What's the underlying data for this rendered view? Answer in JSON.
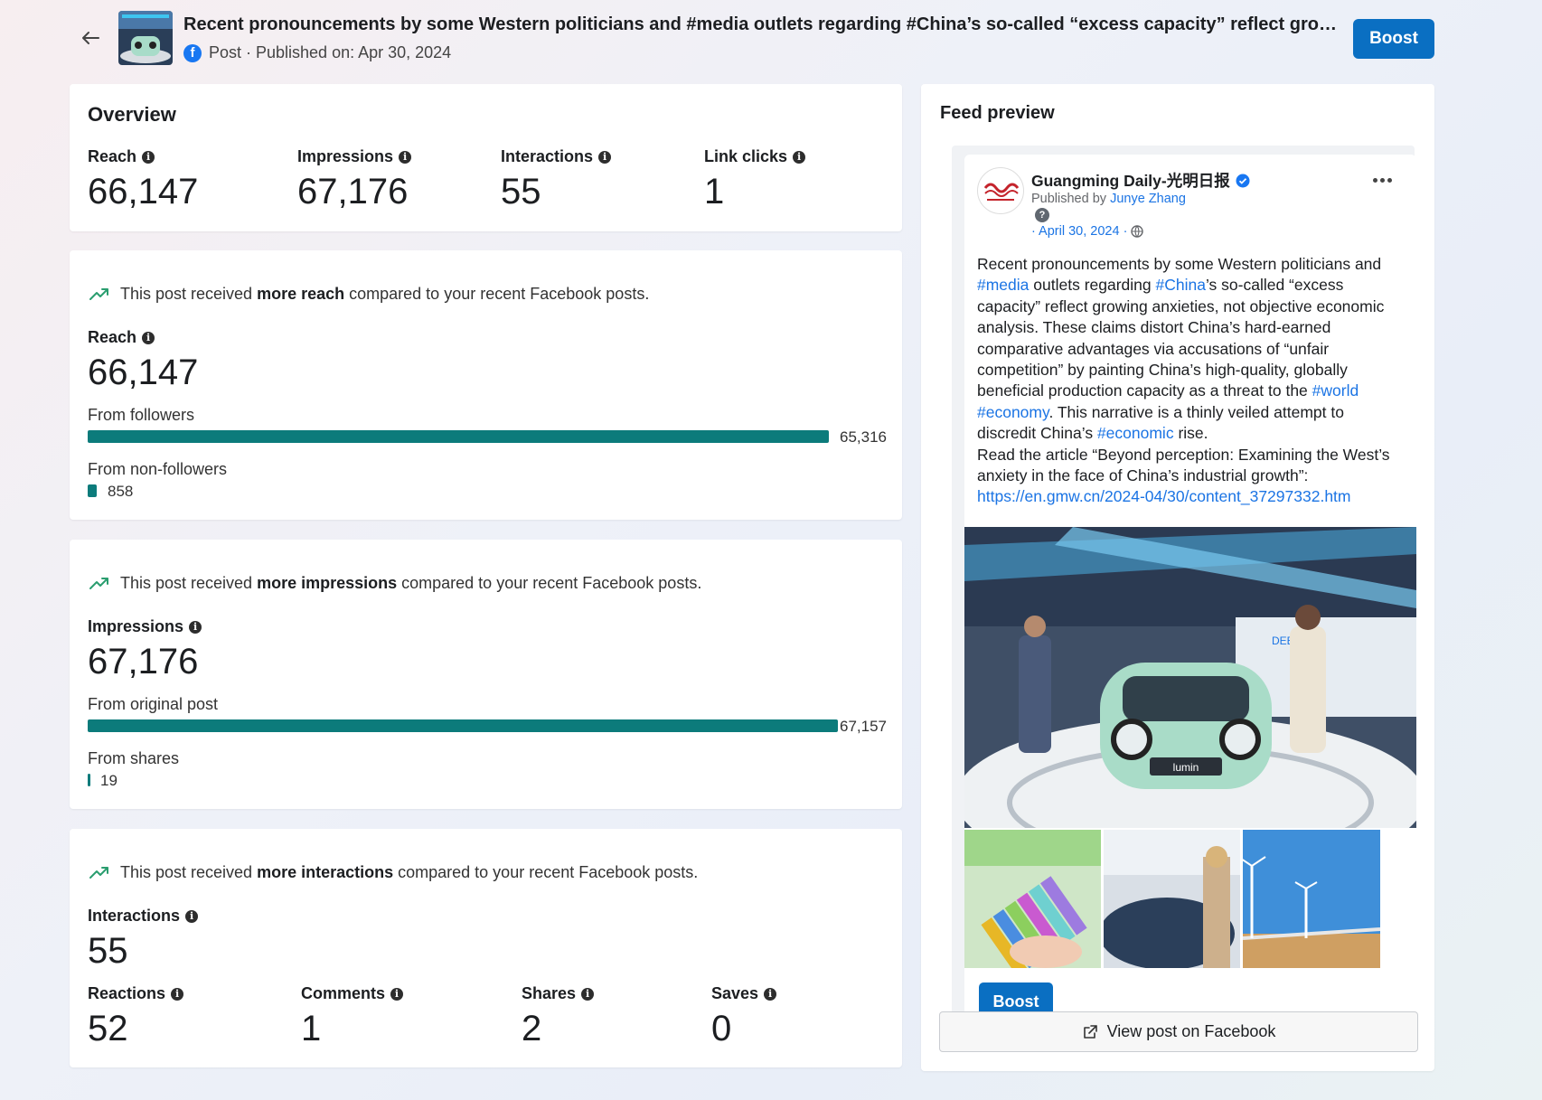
{
  "header": {
    "title": "Recent pronouncements by some Western politicians and #media outlets regarding #China’s so-called “excess capacity” reflect growing anxieties, not objective economic analysis.",
    "subtitle": "Post · Published on: Apr 30, 2024",
    "boost_label": "Boost"
  },
  "overview": {
    "title": "Overview",
    "metrics": [
      {
        "label": "Reach",
        "value": "66,147"
      },
      {
        "label": "Impressions",
        "value": "67,176"
      },
      {
        "label": "Interactions",
        "value": "55"
      },
      {
        "label": "Link clicks",
        "value": "1"
      }
    ]
  },
  "reach_card": {
    "note_pre": "This post received ",
    "note_bold": "more reach",
    "note_post": " compared to your recent Facebook posts.",
    "label": "Reach",
    "value": "66,147",
    "rows": [
      {
        "label": "From followers",
        "value": "65,316",
        "fraction": 0.9874
      },
      {
        "label": "From non-followers",
        "value": "858",
        "fraction": 0.013
      }
    ]
  },
  "impressions_card": {
    "note_pre": "This post received ",
    "note_bold": "more impressions",
    "note_post": " compared to your recent Facebook posts.",
    "label": "Impressions",
    "value": "67,176",
    "rows": [
      {
        "label": "From original post",
        "value": "67,157",
        "fraction": 0.9997
      },
      {
        "label": "From shares",
        "value": "19",
        "fraction": 0.0003
      }
    ]
  },
  "interactions_card": {
    "note_pre": "This post received ",
    "note_bold": "more interactions",
    "note_post": " compared to your recent Facebook posts.",
    "label": "Interactions",
    "value": "55",
    "breakdown": [
      {
        "label": "Reactions",
        "value": "52"
      },
      {
        "label": "Comments",
        "value": "1"
      },
      {
        "label": "Shares",
        "value": "2"
      },
      {
        "label": "Saves",
        "value": "0"
      }
    ]
  },
  "feed_preview": {
    "title": "Feed preview",
    "page_name": "Guangming Daily-光明日报",
    "published_by_prefix": "Published by ",
    "publisher": "Junye Zhang",
    "date": "· April 30, 2024 ·",
    "body": [
      {
        "t": "Recent pronouncements by some Western politicians and "
      },
      {
        "t": "#media",
        "tag": true
      },
      {
        "t": " outlets regarding "
      },
      {
        "t": "#China",
        "tag": true
      },
      {
        "t": "’s so-called “excess capacity” reflect growing anxieties, not objective economic analysis. These claims distort China’s hard-earned comparative advantages via accusations of “unfair competition” by painting China’s high-quality, globally beneficial production capacity as a threat to the "
      },
      {
        "t": "#world",
        "tag": true
      },
      {
        "t": " "
      },
      {
        "t": "#economy",
        "tag": true
      },
      {
        "t": ". This narrative is a thinly veiled attempt to discredit China’s "
      },
      {
        "t": "#economic",
        "tag": true
      },
      {
        "t": " rise."
      },
      {
        "t": "\nRead the article “Beyond perception: Examining the West’s anxiety in the face of China’s industrial growth”:\n"
      },
      {
        "t": "https://en.gmw.cn/2024-04/30/content_37297332.htm",
        "tag": true
      }
    ],
    "boost_label": "Boost",
    "view_label": "View post on Facebook",
    "car_badge": "lumin",
    "banner_text": "DEEPAL"
  }
}
